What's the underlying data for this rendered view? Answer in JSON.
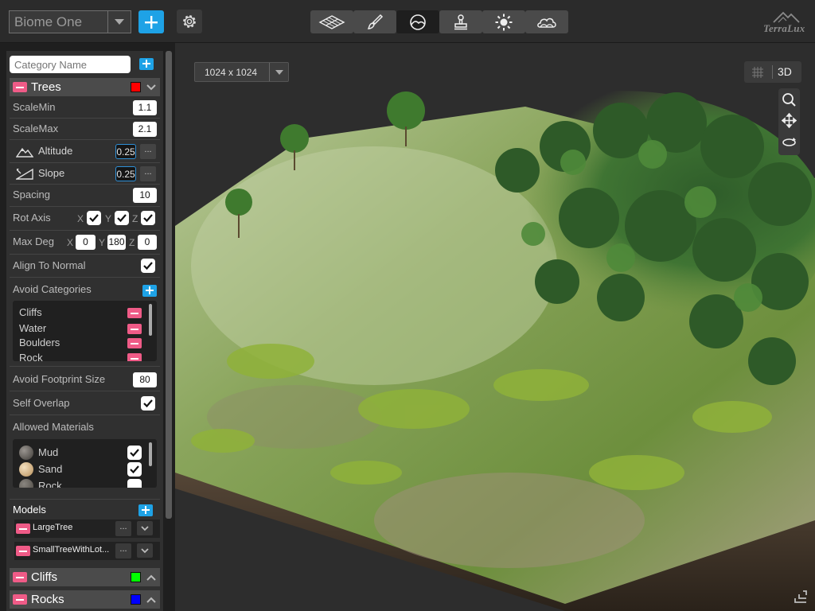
{
  "topbar": {
    "biome_name": "Biome One",
    "tools": [
      "terrain-tool",
      "paint-tool",
      "biome-tool",
      "stamp-tool",
      "lighting-tool",
      "sky-tool"
    ],
    "active_tool": 2,
    "logo_text": "TerraLux"
  },
  "panel": {
    "category_name_placeholder": "Category Name",
    "trees": {
      "name": "Trees",
      "color": "#ff0000",
      "scale_min_label": "ScaleMin",
      "scale_min": "1.1",
      "scale_max_label": "ScaleMax",
      "scale_max": "2.1",
      "altitude_label": "Altitude",
      "altitude": "0.25",
      "slope_label": "Slope",
      "slope": "0.25",
      "more_label": "...",
      "spacing_label": "Spacing",
      "spacing": "10",
      "rot_axis_label": "Rot Axis",
      "rot_axis": {
        "x": true,
        "y": true,
        "z": true
      },
      "max_deg_label": "Max Deg",
      "max_deg": {
        "x": "0",
        "y": "180",
        "z": "0"
      },
      "axis_x": "X",
      "axis_y": "Y",
      "axis_z": "Z",
      "align_label": "Align To Normal",
      "align": true,
      "avoid_categories_label": "Avoid Categories",
      "avoid_categories": [
        "Cliffs",
        "Water",
        "Boulders",
        "Rock"
      ],
      "avoid_footprint_label": "Avoid Footprint Size",
      "avoid_footprint": "80",
      "self_overlap_label": "Self Overlap",
      "self_overlap": true,
      "allowed_materials_label": "Allowed Materials",
      "materials": [
        {
          "name": "Mud",
          "checked": true
        },
        {
          "name": "Sand",
          "checked": true
        },
        {
          "name": "Rock",
          "checked": true
        }
      ],
      "models_label": "Models",
      "models": [
        "LargeTree",
        "SmallTreeWithLot..."
      ]
    },
    "cliffs": {
      "name": "Cliffs",
      "color": "#00ff00"
    },
    "rocks": {
      "name": "Rocks",
      "color": "#0000ff"
    }
  },
  "viewport": {
    "resolution": "1024 x 1024",
    "mode_label": "3D"
  }
}
